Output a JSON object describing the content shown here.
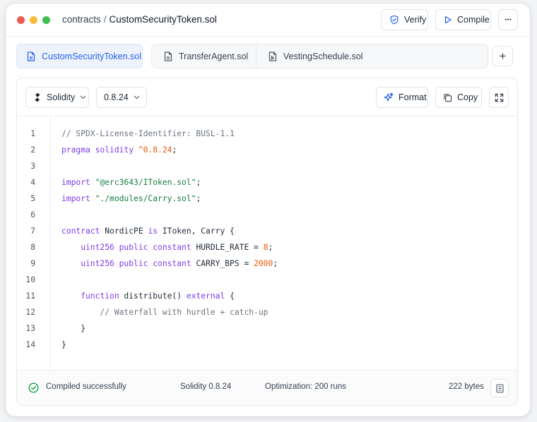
{
  "window": {
    "breadcrumb": {
      "folder": "contracts",
      "separator": "/",
      "file": "CustomSecurityToken.sol"
    },
    "actions": {
      "verify": "Verify",
      "compile": "Compile",
      "more": "···"
    }
  },
  "tabs": {
    "active": "CustomSecurityToken.sol",
    "others": [
      "TransferAgent.sol",
      "VestingSchedule.sol"
    ],
    "add": "+"
  },
  "toolbar": {
    "language": "Solidity",
    "version": "0.8.24",
    "format": "Format",
    "copy": "Copy"
  },
  "code": {
    "line_numbers": [
      "1",
      "2",
      "3",
      "4",
      "5",
      "6",
      "7",
      "8",
      "9",
      "10",
      "11",
      "12",
      "13",
      "14"
    ],
    "lines": [
      [
        {
          "t": "// SPDX-License-Identifier: BUSL-1.1",
          "c": "com"
        }
      ],
      [
        {
          "t": "pragma solidity ",
          "c": "kw"
        },
        {
          "t": "^0.8.24",
          "c": "num"
        },
        {
          "t": ";",
          "c": ""
        }
      ],
      [],
      [
        {
          "t": "import ",
          "c": "kw"
        },
        {
          "t": "\"@erc3643/IToken.sol\"",
          "c": "str"
        },
        {
          "t": ";",
          "c": ""
        }
      ],
      [
        {
          "t": "import ",
          "c": "kw"
        },
        {
          "t": "\"./modules/Carry.sol\"",
          "c": "str"
        },
        {
          "t": ";",
          "c": ""
        }
      ],
      [],
      [
        {
          "t": "contract ",
          "c": "kw"
        },
        {
          "t": "NordicPE ",
          "c": ""
        },
        {
          "t": "is ",
          "c": "kw"
        },
        {
          "t": "IToken, Carry {",
          "c": ""
        }
      ],
      [
        {
          "t": "    uint256 public constant ",
          "c": "kw"
        },
        {
          "t": "HURDLE_RATE = ",
          "c": ""
        },
        {
          "t": "8",
          "c": "num"
        },
        {
          "t": ";",
          "c": ""
        }
      ],
      [
        {
          "t": "    uint256 public constant ",
          "c": "kw"
        },
        {
          "t": "CARRY_BPS = ",
          "c": ""
        },
        {
          "t": "2000",
          "c": "num"
        },
        {
          "t": ";",
          "c": ""
        }
      ],
      [],
      [
        {
          "t": "    function ",
          "c": "kw"
        },
        {
          "t": "distribute() ",
          "c": "fn"
        },
        {
          "t": "external ",
          "c": "kw"
        },
        {
          "t": "{",
          "c": ""
        }
      ],
      [
        {
          "t": "        // Waterfall with hurdle + catch-up",
          "c": "com"
        }
      ],
      [
        {
          "t": "    }",
          "c": ""
        }
      ],
      [
        {
          "t": "}",
          "c": ""
        }
      ]
    ]
  },
  "status": {
    "message": "Compiled successfully",
    "compiler": "Solidity 0.8.24",
    "optimization": "Optimization: 200 runs",
    "size": "222 bytes"
  },
  "colors": {
    "accent": "#2563eb",
    "keyword": "#7c3aed",
    "string": "#15803d",
    "number": "#ea580c",
    "comment": "#6b7280",
    "success": "#16a34a"
  }
}
